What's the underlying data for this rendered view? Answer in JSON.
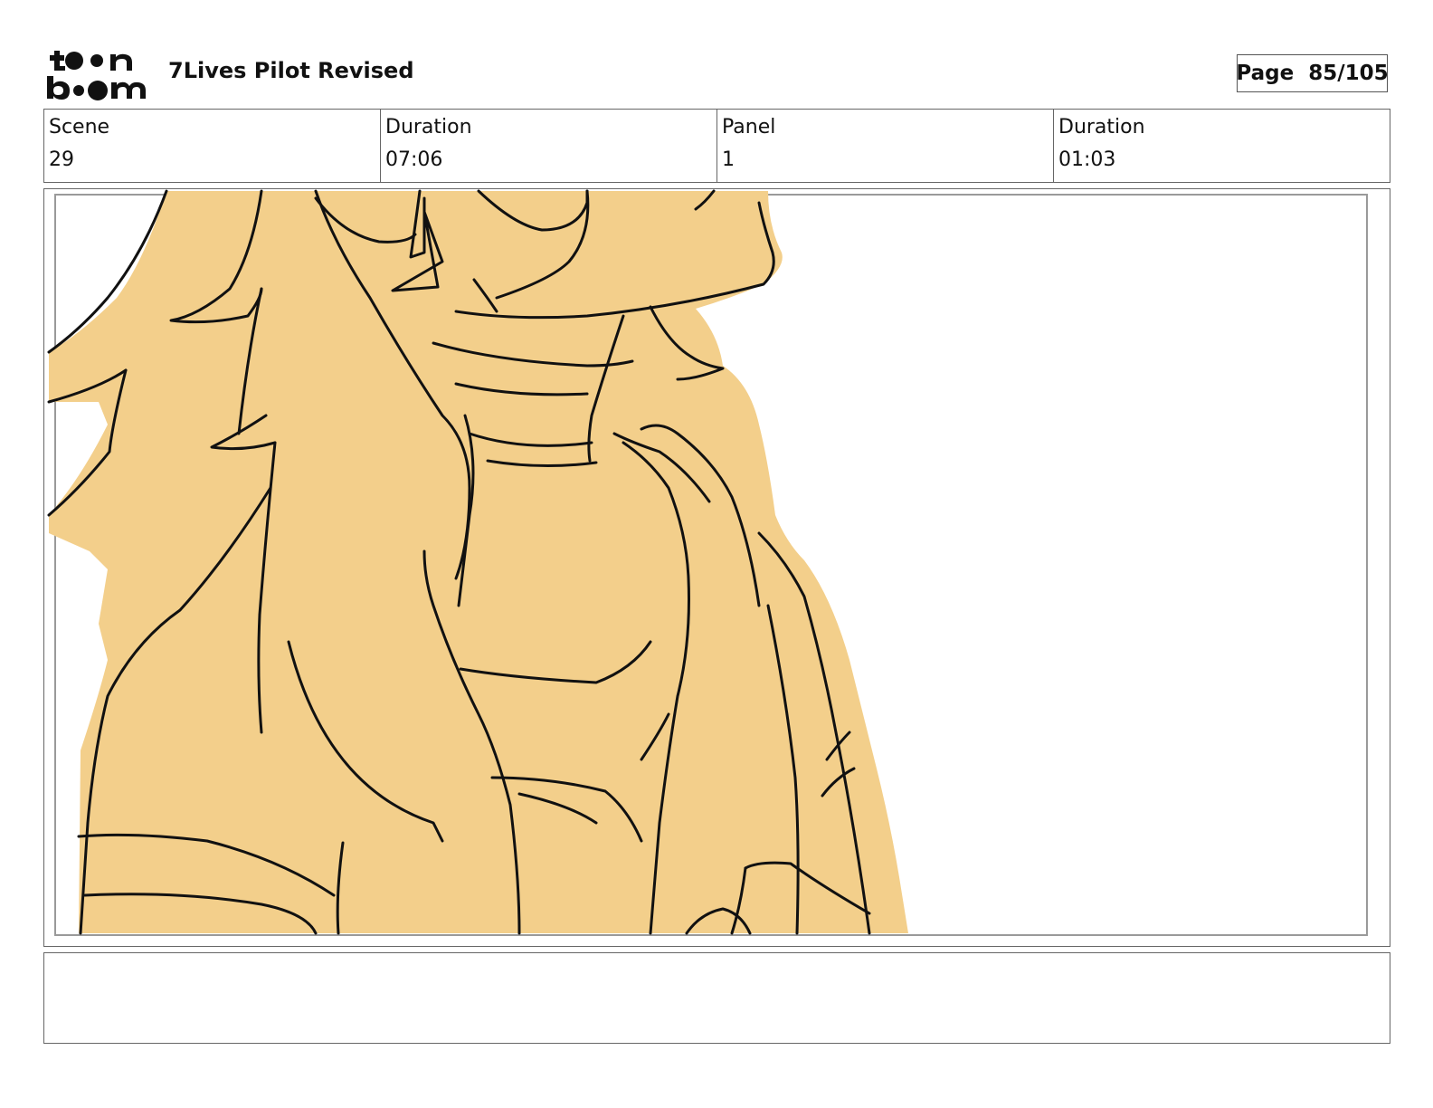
{
  "header": {
    "logo_text": "toon boom",
    "title": "7Lives Pilot Revised",
    "page": "Page  85/105"
  },
  "info": {
    "scene_label": "Scene",
    "scene_value": "29",
    "scene_duration_label": "Duration",
    "scene_duration_value": "07:06",
    "panel_label": "Panel",
    "panel_value": "1",
    "panel_duration_label": "Duration",
    "panel_duration_value": "01:03"
  },
  "colors": {
    "fill": "#F3CF8B",
    "line": "#111111",
    "border": "#666666",
    "safe_frame": "#9A9A9A"
  },
  "notes": {
    "text": ""
  }
}
